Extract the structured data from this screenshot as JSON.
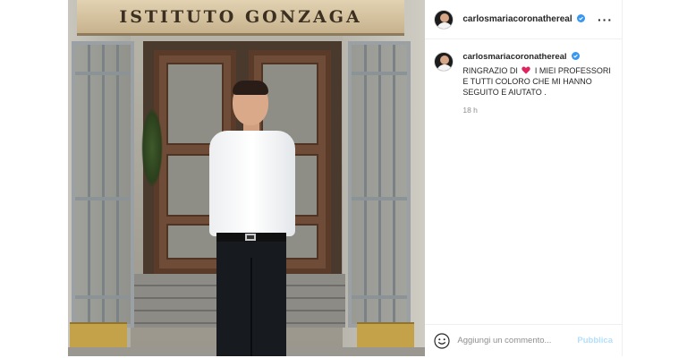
{
  "post": {
    "photo": {
      "sign_text": "ISTITUTO GONZAGA"
    },
    "author": {
      "username": "carlosmariacoronathereal",
      "verified": true,
      "verified_color": "#3897f0"
    },
    "caption": {
      "username": "carlosmariacoronathereal",
      "text_before_heart": "RINGRAZIO DI",
      "text_after_heart": "I MIEI PROFESSORI E TUTTI COLORO CHE MI HANNO SEGUITO E AIUTATO .",
      "heart_color": "#e0245e"
    },
    "time_ago": "18 h",
    "menu_icon": "more-horizontal-icon",
    "comment_box": {
      "placeholder": "Aggiungi un commento...",
      "publish_label": "Pubblica",
      "publish_color": "#b2dffc",
      "emoji_icon": "smile-icon"
    }
  }
}
